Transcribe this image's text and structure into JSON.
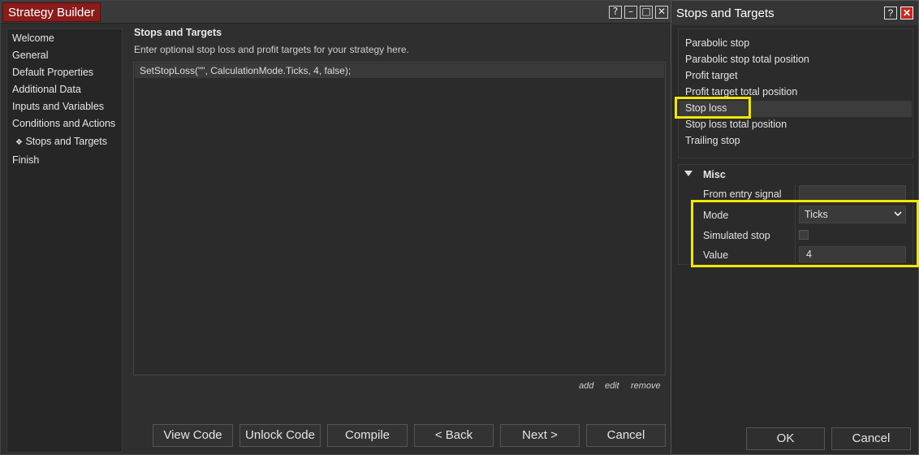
{
  "main_window": {
    "title": "Strategy Builder",
    "controls": {
      "help": "?",
      "minimize": "–",
      "maximize": "□",
      "close": "✕"
    }
  },
  "nav": {
    "items": [
      {
        "label": "Welcome"
      },
      {
        "label": "General"
      },
      {
        "label": "Default Properties"
      },
      {
        "label": "Additional Data"
      },
      {
        "label": "Inputs and Variables"
      },
      {
        "label": "Conditions and Actions"
      },
      {
        "label": "Stops and Targets",
        "active": true,
        "marker": "❖"
      },
      {
        "label": "Finish"
      }
    ]
  },
  "page": {
    "heading": "Stops and Targets",
    "description": "Enter optional stop loss and profit targets for your strategy here.",
    "code_lines": [
      "SetStopLoss(\"\", CalculationMode.Ticks, 4, false);"
    ],
    "links": {
      "add": "add",
      "edit": "edit",
      "remove": "remove"
    }
  },
  "buttons": {
    "view_code": "View Code",
    "unlock_code": "Unlock Code",
    "compile": "Compile",
    "back": "< Back",
    "next": "Next >",
    "cancel": "Cancel"
  },
  "dialog": {
    "title": "Stops and Targets",
    "controls": {
      "help": "?",
      "close": "✕"
    },
    "list": [
      "Parabolic stop",
      "Parabolic stop total position",
      "Profit target",
      "Profit target total position",
      "Stop loss",
      "Stop loss total position",
      "Trailing stop"
    ],
    "selected": "Stop loss",
    "misc": {
      "title": "Misc",
      "from_entry_signal_label": "From entry signal",
      "from_entry_signal_value": "",
      "mode_label": "Mode",
      "mode_value": "Ticks",
      "simulated_stop_label": "Simulated stop",
      "simulated_stop_checked": false,
      "value_label": "Value",
      "value": "4"
    },
    "ok": "OK",
    "cancel": "Cancel"
  },
  "colors": {
    "title_red": "#8a1c1c",
    "highlight": "#f2e600"
  }
}
